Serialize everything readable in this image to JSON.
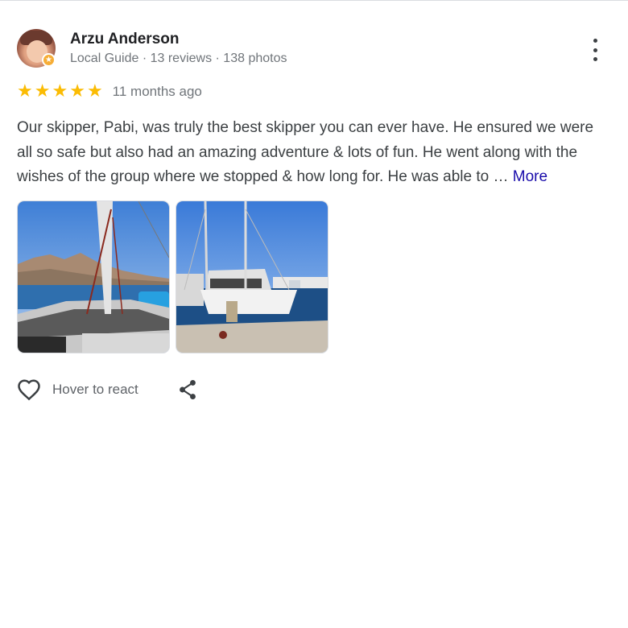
{
  "reviewer": {
    "name": "Arzu Anderson",
    "meta": "Local Guide · 13 reviews · 138 photos",
    "badge_icon": "local-guide-star-icon"
  },
  "rating": {
    "stars": 5,
    "max": 5,
    "time_ago": "11 months ago",
    "star_color": "#fbbc04"
  },
  "review": {
    "text": "Our skipper, Pabi, was truly the best skipper you can ever have. He ensured we were all so safe but also had an amazing adventure & lots of fun. He went along with the wishes of the group where we stopped & how long for. He was able to …",
    "more_label": "More",
    "link_color": "#1a0dab"
  },
  "photos": [
    {
      "icon": "sailboat-deck-photo"
    },
    {
      "icon": "sailboat-harbor-photo"
    }
  ],
  "actions": {
    "react_label": "Hover to react",
    "react_icon": "heart-outline-icon",
    "share_icon": "share-icon",
    "menu_icon": "more-vert-icon"
  }
}
